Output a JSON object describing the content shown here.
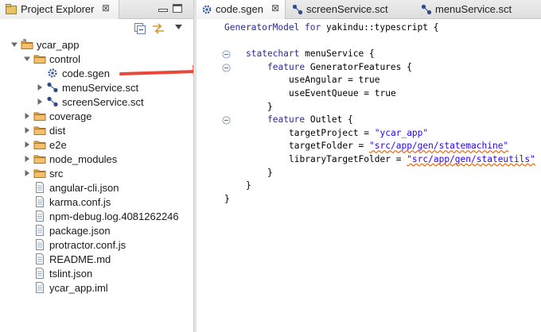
{
  "project_explorer": {
    "tab_title": "Project Explorer",
    "close_glyph": "⊠",
    "icons": {
      "tab": "package-explorer-icon",
      "minimize": "minimize-icon",
      "maximize": "maximize-icon",
      "collapse_all": "collapse-all-icon",
      "link_editor": "link-with-editor-icon",
      "view_menu": "view-menu-icon"
    },
    "tree": [
      {
        "label": "ycar_app",
        "icon": "project-folder-icon",
        "expanded": true
      },
      {
        "label": "control",
        "icon": "folder-icon",
        "expanded": true
      },
      {
        "label": "code.sgen",
        "icon": "generator-model-icon"
      },
      {
        "label": "menuService.sct",
        "icon": "statechart-icon",
        "collapsed": true
      },
      {
        "label": "screenService.sct",
        "icon": "statechart-icon",
        "collapsed": true
      },
      {
        "label": "coverage",
        "icon": "folder-icon",
        "collapsed": true
      },
      {
        "label": "dist",
        "icon": "folder-icon",
        "collapsed": true
      },
      {
        "label": "e2e",
        "icon": "folder-icon",
        "collapsed": true
      },
      {
        "label": "node_modules",
        "icon": "folder-icon",
        "collapsed": true
      },
      {
        "label": "src",
        "icon": "folder-icon",
        "collapsed": true
      },
      {
        "label": "angular-cli.json",
        "icon": "file-icon"
      },
      {
        "label": "karma.conf.js",
        "icon": "file-icon"
      },
      {
        "label": "npm-debug.log.4081262246",
        "icon": "file-icon"
      },
      {
        "label": "package.json",
        "icon": "file-icon"
      },
      {
        "label": "protractor.conf.js",
        "icon": "file-icon"
      },
      {
        "label": "README.md",
        "icon": "file-icon"
      },
      {
        "label": "tslint.json",
        "icon": "file-icon"
      },
      {
        "label": "ycar_app.iml",
        "icon": "file-icon"
      }
    ]
  },
  "editor": {
    "tabs": [
      {
        "label": "code.sgen",
        "icon": "generator-model-icon",
        "active": true,
        "close_glyph": "⊠"
      },
      {
        "label": "screenService.sct",
        "icon": "statechart-icon",
        "active": false
      },
      {
        "label": "menuService.sct",
        "icon": "statechart-icon",
        "active": false
      }
    ],
    "code": [
      {
        "indent": 0,
        "parts": [
          {
            "t": "GeneratorModel for ",
            "c": "kw"
          },
          {
            "t": "yakindu::typescript {"
          }
        ]
      },
      {
        "indent": 0,
        "parts": []
      },
      {
        "indent": 1,
        "parts": [
          {
            "t": "statechart ",
            "c": "kw"
          },
          {
            "t": "menuService {"
          }
        ]
      },
      {
        "indent": 2,
        "parts": [
          {
            "t": "feature ",
            "c": "kw"
          },
          {
            "t": "GeneratorFeatures {"
          }
        ]
      },
      {
        "indent": 3,
        "parts": [
          {
            "t": "useAngular = true"
          }
        ]
      },
      {
        "indent": 3,
        "parts": [
          {
            "t": "useEventQueue = true"
          }
        ]
      },
      {
        "indent": 2,
        "parts": [
          {
            "t": "}"
          }
        ]
      },
      {
        "indent": 2,
        "parts": [
          {
            "t": "feature ",
            "c": "kw"
          },
          {
            "t": "Outlet {"
          }
        ]
      },
      {
        "indent": 3,
        "parts": [
          {
            "t": "targetProject = "
          },
          {
            "t": "\"ycar_app\"",
            "c": "str"
          }
        ]
      },
      {
        "indent": 3,
        "parts": [
          {
            "t": "targetFolder = "
          },
          {
            "t": "\"src/app/gen/statemachine\"",
            "c": "str",
            "squig": true
          }
        ]
      },
      {
        "indent": 3,
        "parts": [
          {
            "t": "libraryTargetFolder = "
          },
          {
            "t": "\"src/app/gen/stateutils\"",
            "c": "str",
            "squig": true
          }
        ]
      },
      {
        "indent": 2,
        "parts": [
          {
            "t": "}"
          }
        ]
      },
      {
        "indent": 1,
        "parts": [
          {
            "t": "}"
          }
        ]
      },
      {
        "indent": 0,
        "parts": [
          {
            "t": "}"
          }
        ]
      }
    ],
    "fold_icon": "collapse-fold-icon"
  },
  "colors": {
    "keyword": "#2a2a9a",
    "string": "#2a00ff",
    "arrow": "#e8473a",
    "folder": "#e9a84a"
  },
  "annotation": {
    "icon": "red-arrow-icon"
  }
}
